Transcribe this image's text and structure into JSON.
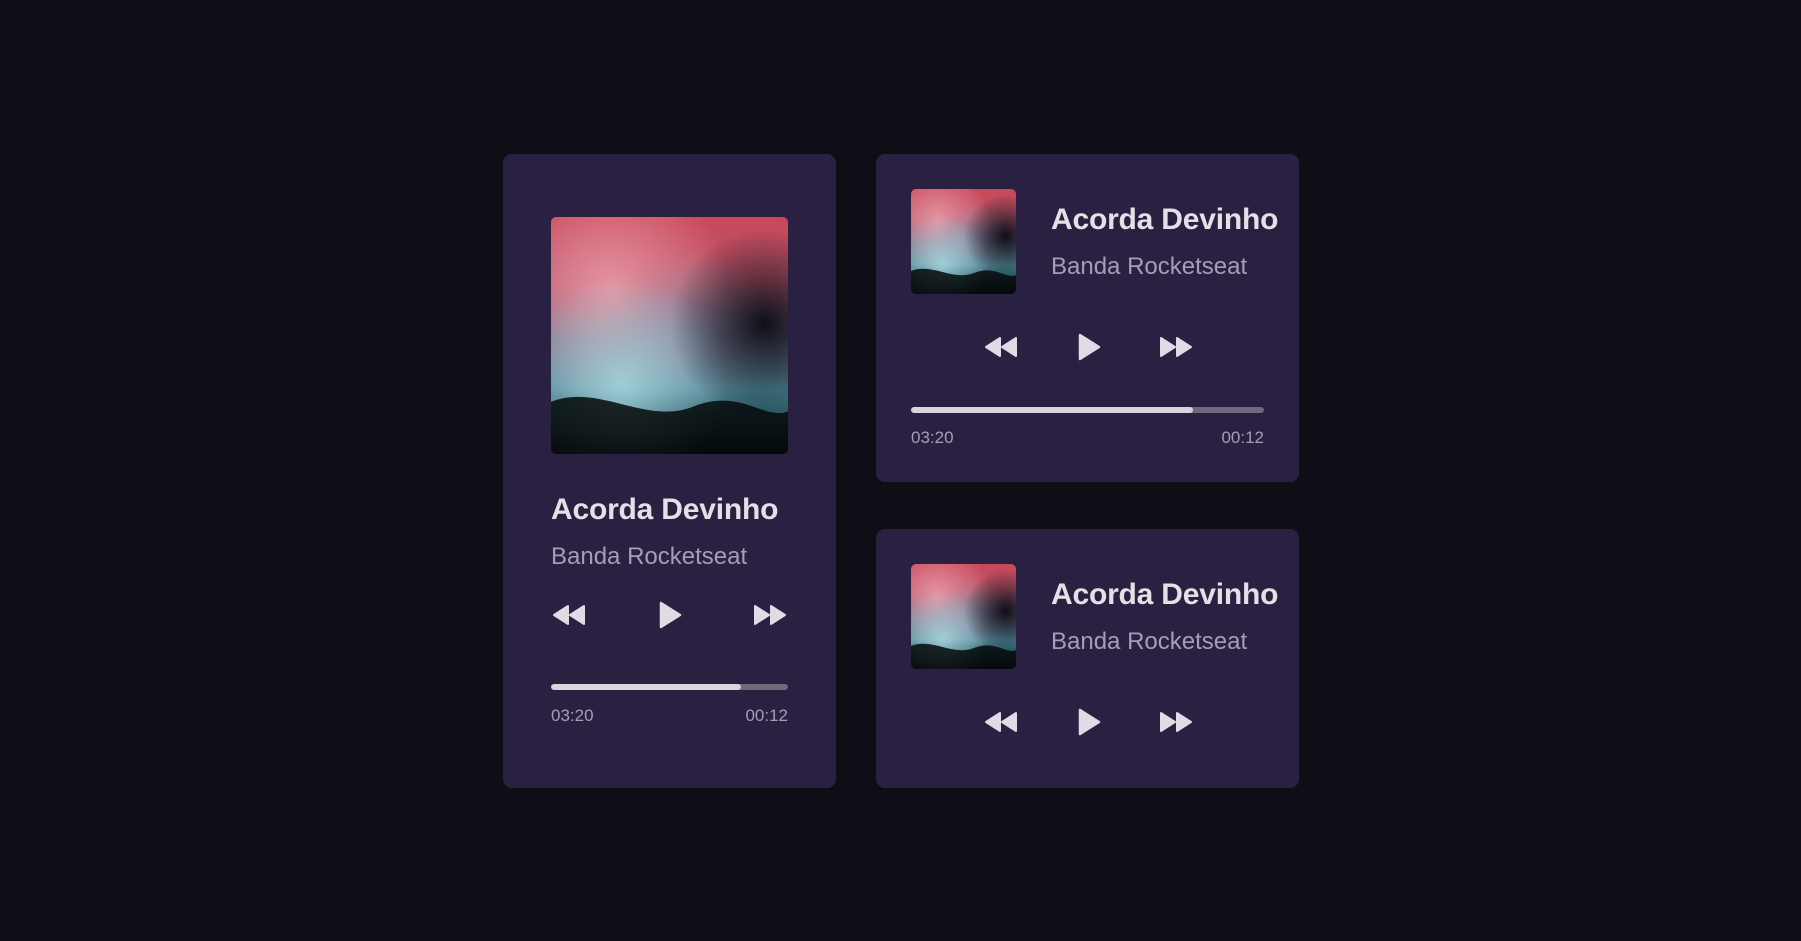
{
  "colors": {
    "page_background": "#0f0d15",
    "card_background": "#2a2142",
    "title_text": "#e4e1e6",
    "secondary_text": "#a39fb3",
    "progress_fill": "#d9d4de",
    "progress_track": "#6e6a7c"
  },
  "players": [
    {
      "variant": "large",
      "cover_icon": "album-cover-image",
      "title": "Acorda Devinho",
      "artist": "Banda Rocketseat",
      "controls": [
        "rewind-icon",
        "play-icon",
        "fast-forward-icon"
      ],
      "progress": 0.8,
      "time_elapsed": "03:20",
      "time_total": "00:12"
    },
    {
      "variant": "compact",
      "cover_icon": "album-cover-image",
      "title": "Acorda Devinho",
      "artist": "Banda Rocketseat",
      "controls": [
        "rewind-icon",
        "play-icon",
        "fast-forward-icon"
      ],
      "progress": 0.8,
      "time_elapsed": "03:20",
      "time_total": "00:12"
    },
    {
      "variant": "compact-no-progress",
      "cover_icon": "album-cover-image",
      "title": "Acorda Devinho",
      "artist": "Banda Rocketseat",
      "controls": [
        "rewind-icon",
        "play-icon",
        "fast-forward-icon"
      ]
    }
  ]
}
